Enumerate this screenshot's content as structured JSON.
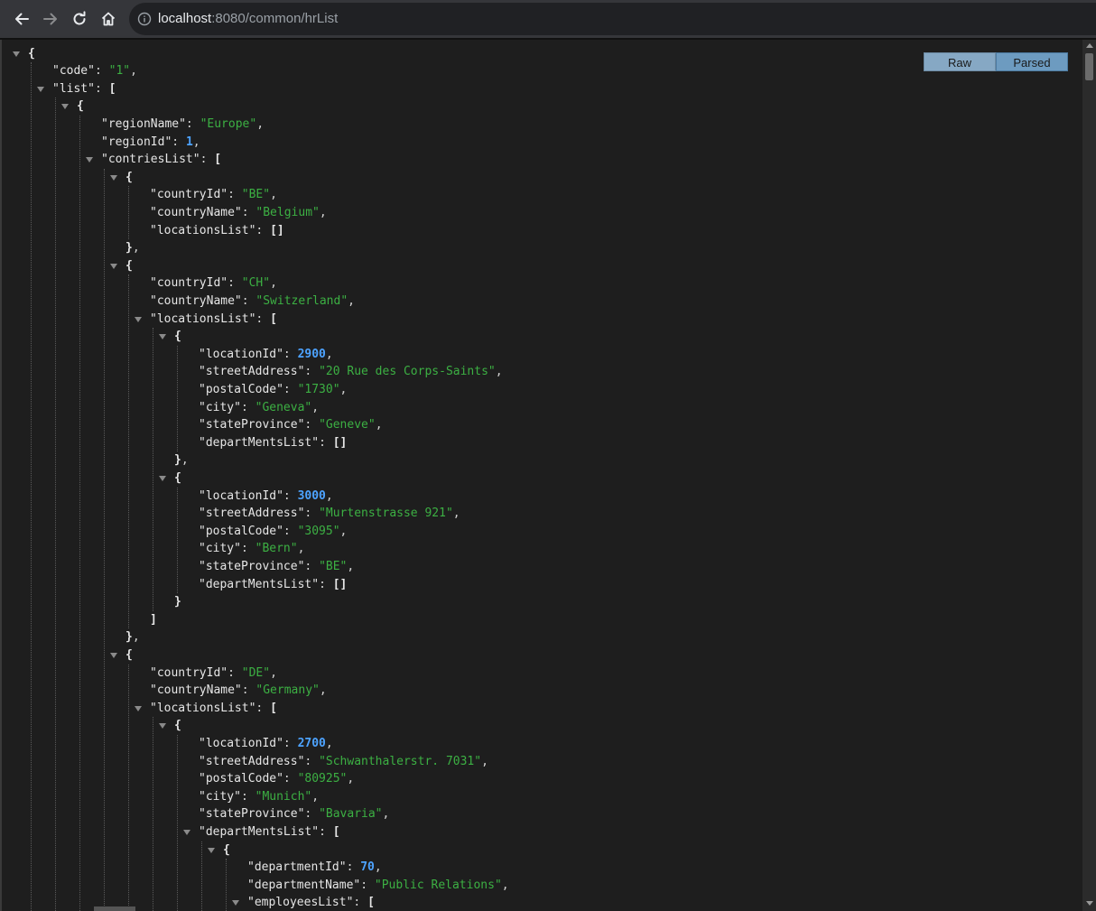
{
  "browser": {
    "url_host": "localhost",
    "url_rest": ":8080/common/hrList"
  },
  "view_switch": {
    "raw_label": "Raw",
    "parsed_label": "Parsed"
  },
  "json_lines": [
    {
      "d": 0,
      "t": true,
      "parts": [
        [
          "b",
          "{"
        ]
      ]
    },
    {
      "d": 1,
      "parts": [
        [
          "k",
          "\"code\""
        ],
        [
          "p",
          ": "
        ],
        [
          "s",
          "\"1\""
        ],
        [
          "p",
          ","
        ]
      ]
    },
    {
      "d": 1,
      "t": true,
      "parts": [
        [
          "k",
          "\"list\""
        ],
        [
          "p",
          ": "
        ],
        [
          "b",
          "["
        ]
      ]
    },
    {
      "d": 2,
      "t": true,
      "parts": [
        [
          "b",
          "{"
        ]
      ]
    },
    {
      "d": 3,
      "parts": [
        [
          "k",
          "\"regionName\""
        ],
        [
          "p",
          ": "
        ],
        [
          "s",
          "\"Europe\""
        ],
        [
          "p",
          ","
        ]
      ]
    },
    {
      "d": 3,
      "parts": [
        [
          "k",
          "\"regionId\""
        ],
        [
          "p",
          ": "
        ],
        [
          "n",
          "1"
        ],
        [
          "p",
          ","
        ]
      ]
    },
    {
      "d": 3,
      "t": true,
      "parts": [
        [
          "k",
          "\"contriesList\""
        ],
        [
          "p",
          ": "
        ],
        [
          "b",
          "["
        ]
      ]
    },
    {
      "d": 4,
      "t": true,
      "parts": [
        [
          "b",
          "{"
        ]
      ]
    },
    {
      "d": 5,
      "parts": [
        [
          "k",
          "\"countryId\""
        ],
        [
          "p",
          ": "
        ],
        [
          "s",
          "\"BE\""
        ],
        [
          "p",
          ","
        ]
      ]
    },
    {
      "d": 5,
      "parts": [
        [
          "k",
          "\"countryName\""
        ],
        [
          "p",
          ": "
        ],
        [
          "s",
          "\"Belgium\""
        ],
        [
          "p",
          ","
        ]
      ]
    },
    {
      "d": 5,
      "parts": [
        [
          "k",
          "\"locationsList\""
        ],
        [
          "p",
          ": "
        ],
        [
          "b",
          "[]"
        ]
      ]
    },
    {
      "d": 4,
      "parts": [
        [
          "b",
          "}"
        ],
        [
          "p",
          ","
        ]
      ]
    },
    {
      "d": 4,
      "t": true,
      "parts": [
        [
          "b",
          "{"
        ]
      ]
    },
    {
      "d": 5,
      "parts": [
        [
          "k",
          "\"countryId\""
        ],
        [
          "p",
          ": "
        ],
        [
          "s",
          "\"CH\""
        ],
        [
          "p",
          ","
        ]
      ]
    },
    {
      "d": 5,
      "parts": [
        [
          "k",
          "\"countryName\""
        ],
        [
          "p",
          ": "
        ],
        [
          "s",
          "\"Switzerland\""
        ],
        [
          "p",
          ","
        ]
      ]
    },
    {
      "d": 5,
      "t": true,
      "parts": [
        [
          "k",
          "\"locationsList\""
        ],
        [
          "p",
          ": "
        ],
        [
          "b",
          "["
        ]
      ]
    },
    {
      "d": 6,
      "t": true,
      "parts": [
        [
          "b",
          "{"
        ]
      ]
    },
    {
      "d": 7,
      "parts": [
        [
          "k",
          "\"locationId\""
        ],
        [
          "p",
          ": "
        ],
        [
          "n",
          "2900"
        ],
        [
          "p",
          ","
        ]
      ]
    },
    {
      "d": 7,
      "parts": [
        [
          "k",
          "\"streetAddress\""
        ],
        [
          "p",
          ": "
        ],
        [
          "s",
          "\"20 Rue des Corps-Saints\""
        ],
        [
          "p",
          ","
        ]
      ]
    },
    {
      "d": 7,
      "parts": [
        [
          "k",
          "\"postalCode\""
        ],
        [
          "p",
          ": "
        ],
        [
          "s",
          "\"1730\""
        ],
        [
          "p",
          ","
        ]
      ]
    },
    {
      "d": 7,
      "parts": [
        [
          "k",
          "\"city\""
        ],
        [
          "p",
          ": "
        ],
        [
          "s",
          "\"Geneva\""
        ],
        [
          "p",
          ","
        ]
      ]
    },
    {
      "d": 7,
      "parts": [
        [
          "k",
          "\"stateProvince\""
        ],
        [
          "p",
          ": "
        ],
        [
          "s",
          "\"Geneve\""
        ],
        [
          "p",
          ","
        ]
      ]
    },
    {
      "d": 7,
      "parts": [
        [
          "k",
          "\"departMentsList\""
        ],
        [
          "p",
          ": "
        ],
        [
          "b",
          "[]"
        ]
      ]
    },
    {
      "d": 6,
      "parts": [
        [
          "b",
          "}"
        ],
        [
          "p",
          ","
        ]
      ]
    },
    {
      "d": 6,
      "t": true,
      "parts": [
        [
          "b",
          "{"
        ]
      ]
    },
    {
      "d": 7,
      "parts": [
        [
          "k",
          "\"locationId\""
        ],
        [
          "p",
          ": "
        ],
        [
          "n",
          "3000"
        ],
        [
          "p",
          ","
        ]
      ]
    },
    {
      "d": 7,
      "parts": [
        [
          "k",
          "\"streetAddress\""
        ],
        [
          "p",
          ": "
        ],
        [
          "s",
          "\"Murtenstrasse 921\""
        ],
        [
          "p",
          ","
        ]
      ]
    },
    {
      "d": 7,
      "parts": [
        [
          "k",
          "\"postalCode\""
        ],
        [
          "p",
          ": "
        ],
        [
          "s",
          "\"3095\""
        ],
        [
          "p",
          ","
        ]
      ]
    },
    {
      "d": 7,
      "parts": [
        [
          "k",
          "\"city\""
        ],
        [
          "p",
          ": "
        ],
        [
          "s",
          "\"Bern\""
        ],
        [
          "p",
          ","
        ]
      ]
    },
    {
      "d": 7,
      "parts": [
        [
          "k",
          "\"stateProvince\""
        ],
        [
          "p",
          ": "
        ],
        [
          "s",
          "\"BE\""
        ],
        [
          "p",
          ","
        ]
      ]
    },
    {
      "d": 7,
      "parts": [
        [
          "k",
          "\"departMentsList\""
        ],
        [
          "p",
          ": "
        ],
        [
          "b",
          "[]"
        ]
      ]
    },
    {
      "d": 6,
      "parts": [
        [
          "b",
          "}"
        ]
      ]
    },
    {
      "d": 5,
      "parts": [
        [
          "b",
          "]"
        ]
      ]
    },
    {
      "d": 4,
      "parts": [
        [
          "b",
          "}"
        ],
        [
          "p",
          ","
        ]
      ]
    },
    {
      "d": 4,
      "t": true,
      "parts": [
        [
          "b",
          "{"
        ]
      ]
    },
    {
      "d": 5,
      "parts": [
        [
          "k",
          "\"countryId\""
        ],
        [
          "p",
          ": "
        ],
        [
          "s",
          "\"DE\""
        ],
        [
          "p",
          ","
        ]
      ]
    },
    {
      "d": 5,
      "parts": [
        [
          "k",
          "\"countryName\""
        ],
        [
          "p",
          ": "
        ],
        [
          "s",
          "\"Germany\""
        ],
        [
          "p",
          ","
        ]
      ]
    },
    {
      "d": 5,
      "t": true,
      "parts": [
        [
          "k",
          "\"locationsList\""
        ],
        [
          "p",
          ": "
        ],
        [
          "b",
          "["
        ]
      ]
    },
    {
      "d": 6,
      "t": true,
      "parts": [
        [
          "b",
          "{"
        ]
      ]
    },
    {
      "d": 7,
      "parts": [
        [
          "k",
          "\"locationId\""
        ],
        [
          "p",
          ": "
        ],
        [
          "n",
          "2700"
        ],
        [
          "p",
          ","
        ]
      ]
    },
    {
      "d": 7,
      "parts": [
        [
          "k",
          "\"streetAddress\""
        ],
        [
          "p",
          ": "
        ],
        [
          "s",
          "\"Schwanthalerstr. 7031\""
        ],
        [
          "p",
          ","
        ]
      ]
    },
    {
      "d": 7,
      "parts": [
        [
          "k",
          "\"postalCode\""
        ],
        [
          "p",
          ": "
        ],
        [
          "s",
          "\"80925\""
        ],
        [
          "p",
          ","
        ]
      ]
    },
    {
      "d": 7,
      "parts": [
        [
          "k",
          "\"city\""
        ],
        [
          "p",
          ": "
        ],
        [
          "s",
          "\"Munich\""
        ],
        [
          "p",
          ","
        ]
      ]
    },
    {
      "d": 7,
      "parts": [
        [
          "k",
          "\"stateProvince\""
        ],
        [
          "p",
          ": "
        ],
        [
          "s",
          "\"Bavaria\""
        ],
        [
          "p",
          ","
        ]
      ]
    },
    {
      "d": 7,
      "t": true,
      "parts": [
        [
          "k",
          "\"departMentsList\""
        ],
        [
          "p",
          ": "
        ],
        [
          "b",
          "["
        ]
      ]
    },
    {
      "d": 8,
      "t": true,
      "parts": [
        [
          "b",
          "{"
        ]
      ]
    },
    {
      "d": 9,
      "parts": [
        [
          "k",
          "\"departmentId\""
        ],
        [
          "p",
          ": "
        ],
        [
          "n",
          "70"
        ],
        [
          "p",
          ","
        ]
      ]
    },
    {
      "d": 9,
      "parts": [
        [
          "k",
          "\"departmentName\""
        ],
        [
          "p",
          ": "
        ],
        [
          "s",
          "\"Public Relations\""
        ],
        [
          "p",
          ","
        ]
      ]
    },
    {
      "d": 9,
      "t": true,
      "parts": [
        [
          "k",
          "\"employeesList\""
        ],
        [
          "p",
          ": "
        ],
        [
          "b",
          "["
        ]
      ]
    }
  ]
}
